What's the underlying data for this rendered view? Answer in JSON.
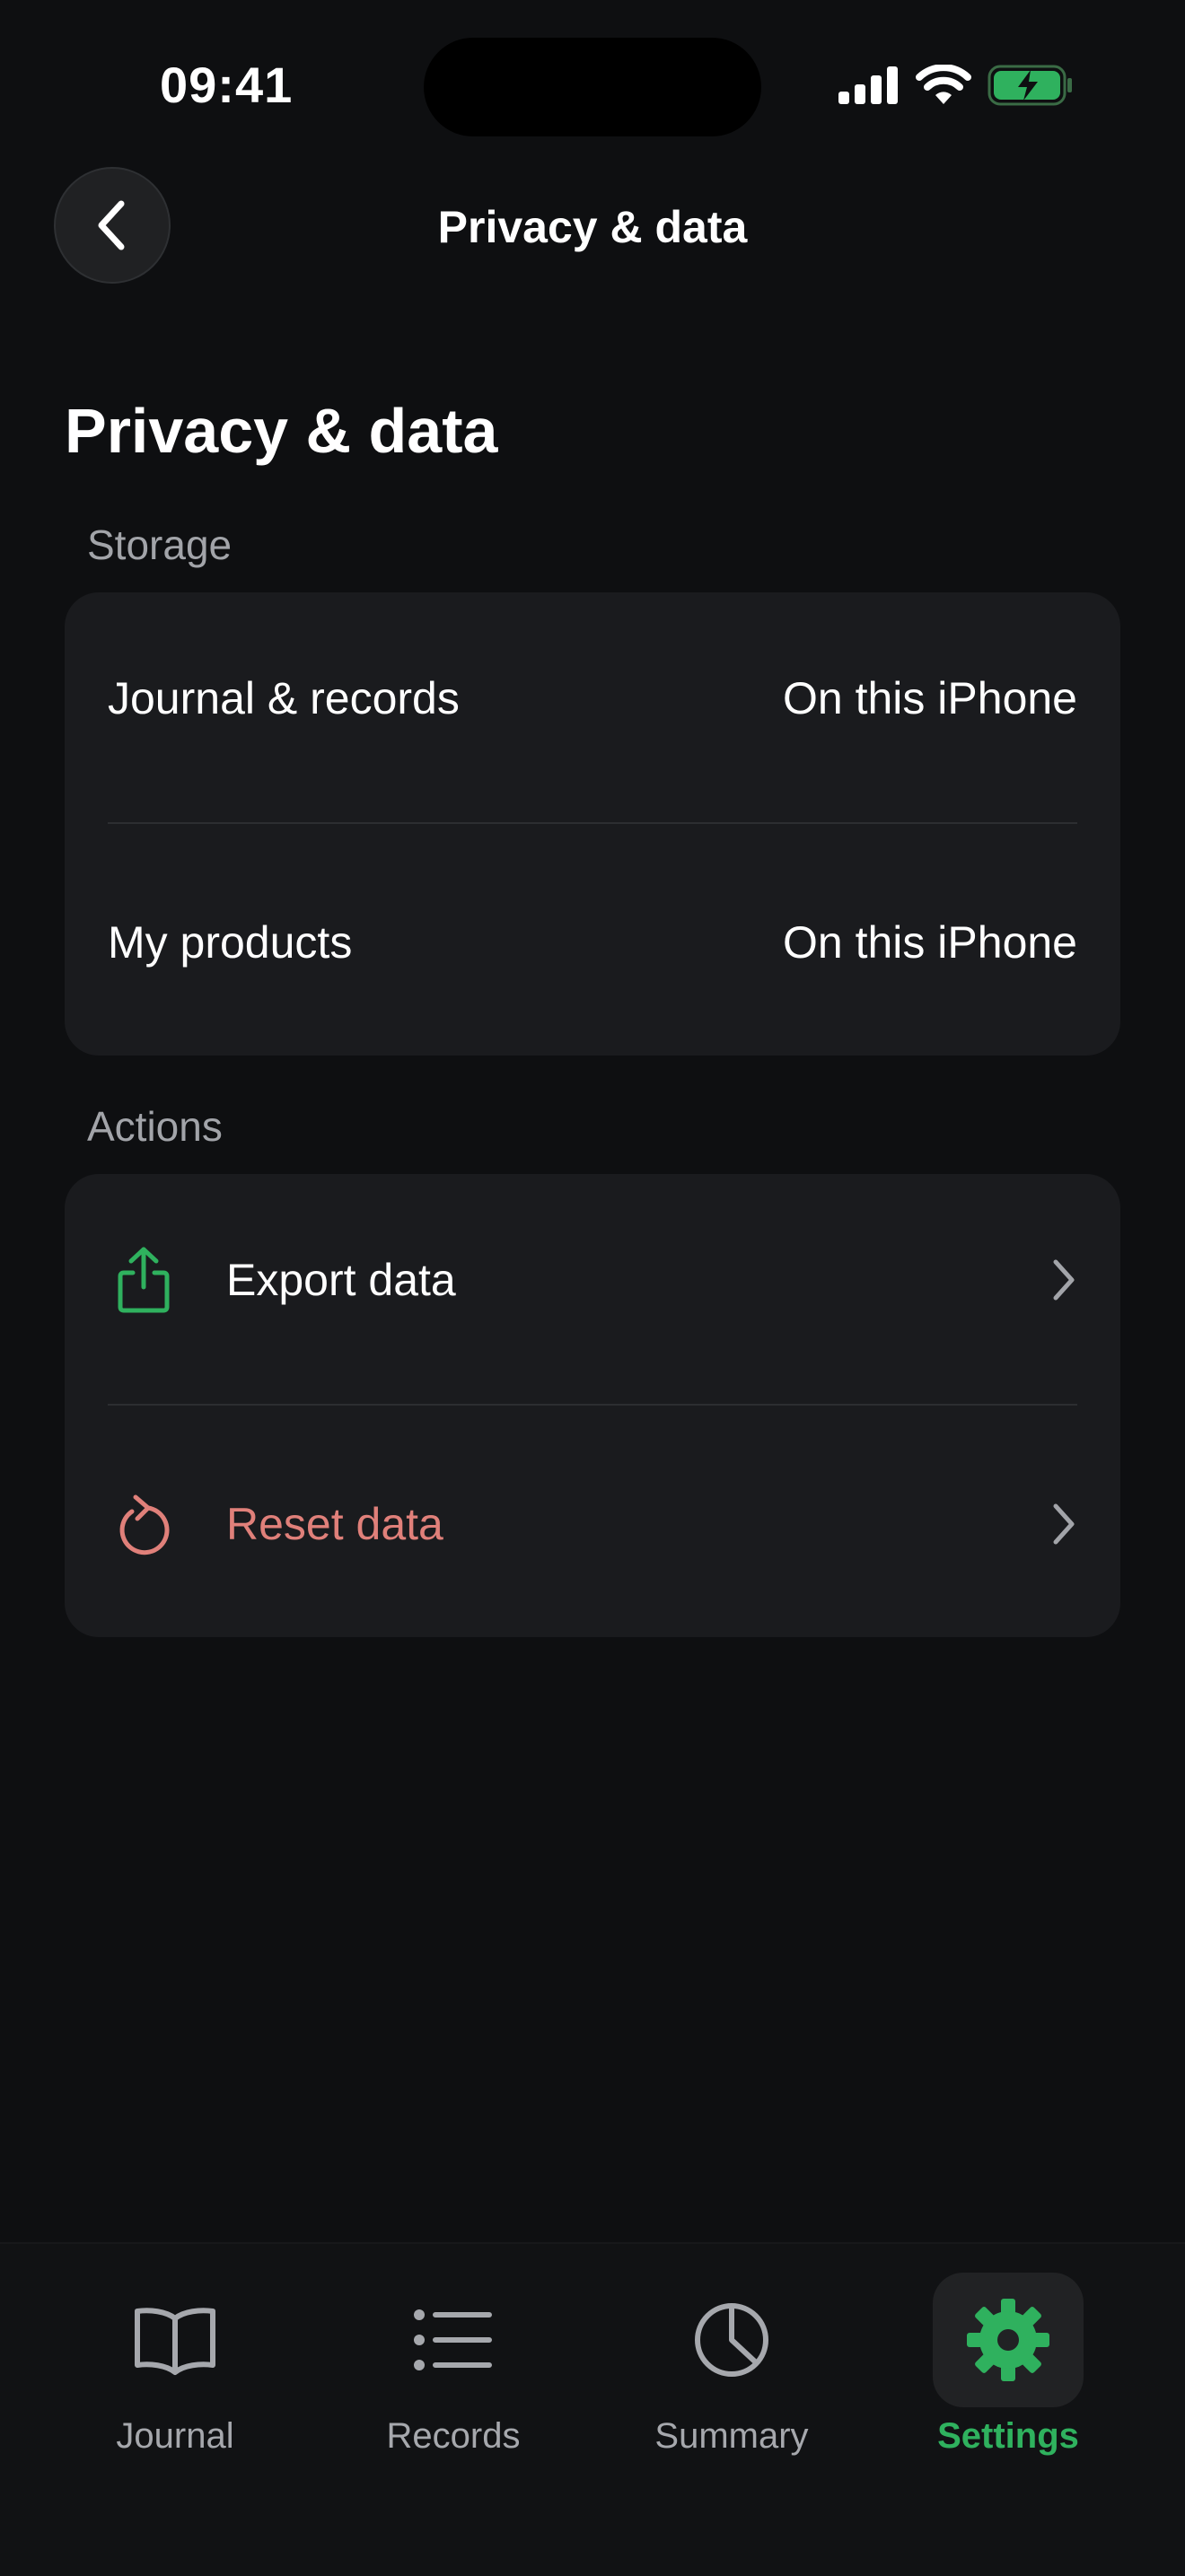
{
  "status_bar": {
    "time": "09:41"
  },
  "header": {
    "title": "Privacy & data",
    "back_icon": "chevron-left-icon"
  },
  "page": {
    "title": "Privacy & data"
  },
  "storage": {
    "label": "Storage",
    "rows": [
      {
        "label": "Journal & records",
        "value": "On this iPhone"
      },
      {
        "label": "My products",
        "value": "On this iPhone"
      }
    ]
  },
  "actions": {
    "label": "Actions",
    "items": [
      {
        "label": "Export data",
        "icon": "share-icon",
        "color": "#2fb15e"
      },
      {
        "label": "Reset data",
        "icon": "reset-icon",
        "color": "#e0807a"
      }
    ]
  },
  "tab_bar": {
    "tabs": [
      {
        "label": "Journal",
        "icon": "book-icon",
        "active": false
      },
      {
        "label": "Records",
        "icon": "list-icon",
        "active": false
      },
      {
        "label": "Summary",
        "icon": "pie-chart-icon",
        "active": false
      },
      {
        "label": "Settings",
        "icon": "gear-icon",
        "active": true
      }
    ]
  },
  "colors": {
    "background": "#0e0f11",
    "card": "#1a1b1e",
    "accent": "#2fb15e",
    "destructive": "#e0807a",
    "secondary_text": "#a2a4a9"
  }
}
